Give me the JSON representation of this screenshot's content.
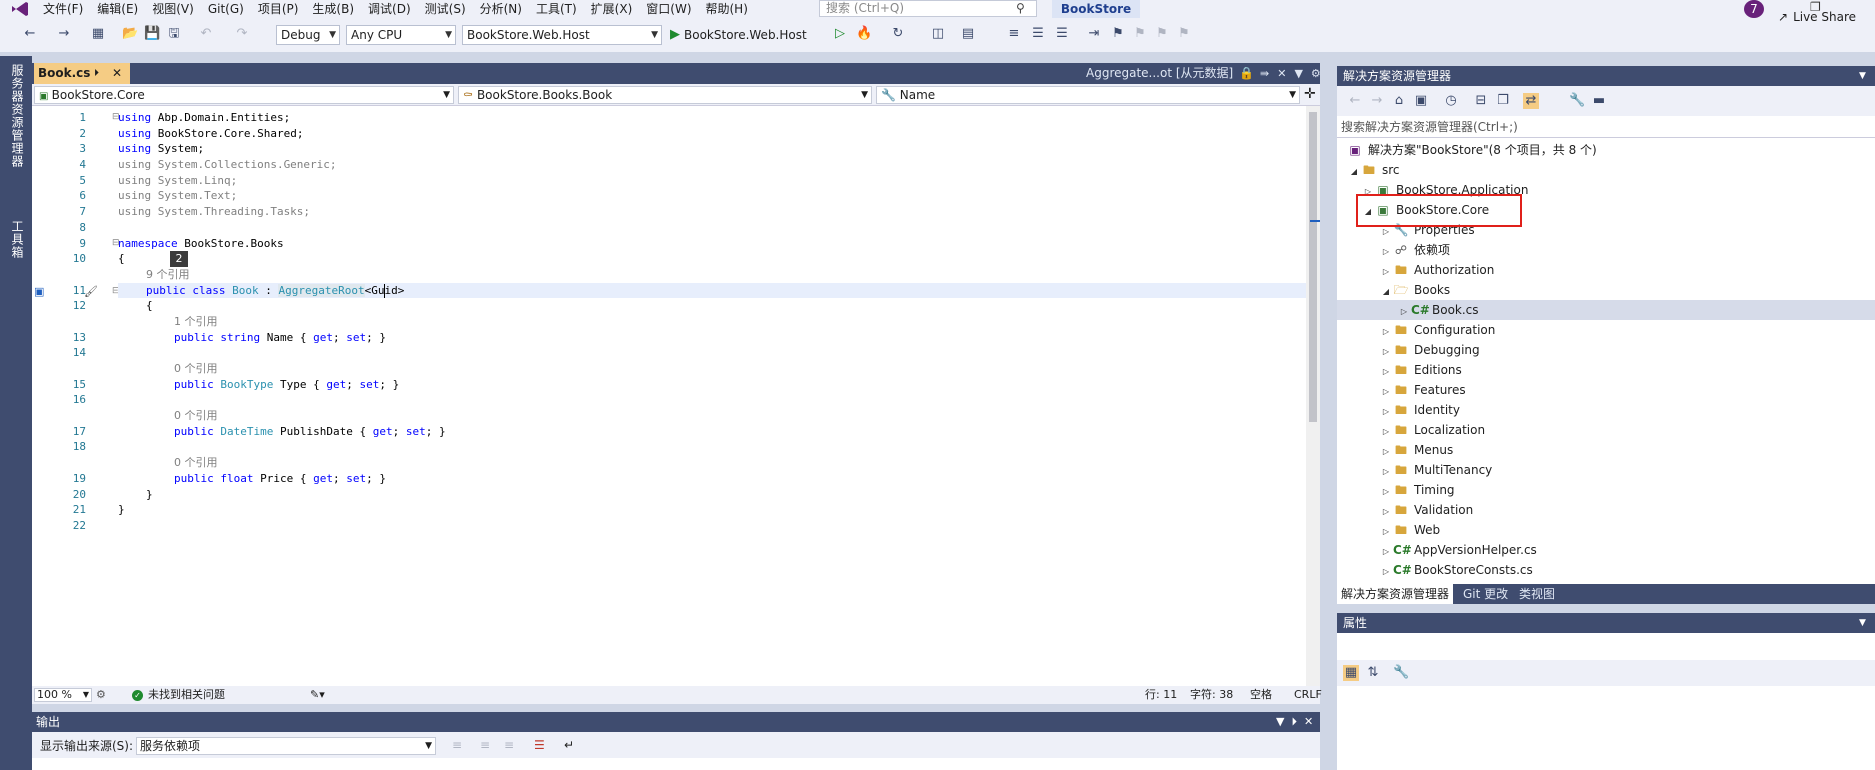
{
  "menubar": {
    "items": [
      "文件(F)",
      "编辑(E)",
      "视图(V)",
      "Git(G)",
      "项目(P)",
      "生成(B)",
      "调试(D)",
      "测试(S)",
      "分析(N)",
      "工具(T)",
      "扩展(X)",
      "窗口(W)",
      "帮助(H)"
    ],
    "search_placeholder": "搜索 (Ctrl+Q)",
    "solution_name": "BookStore",
    "notification_count": "7"
  },
  "toolbar": {
    "config": "Debug",
    "platform": "Any CPU",
    "startup_project": "BookStore.Web.Host",
    "run_target": "BookStore.Web.Host",
    "live_share": "Live Share"
  },
  "side_tabs": [
    "服务器资源管理器",
    "工具箱"
  ],
  "editor": {
    "active_tab": "Book.cs",
    "preview_tab": "Aggregate...ot [从元数据]",
    "nav_project": "BookStore.Core",
    "nav_class": "BookStore.Books.Book",
    "nav_member": "Name",
    "tooltip_number": "2",
    "line_numbers": [
      "1",
      "2",
      "3",
      "4",
      "5",
      "6",
      "7",
      "8",
      "9",
      "10",
      "11",
      "12",
      "13",
      "14",
      "15",
      "16",
      "17",
      "18",
      "19",
      "20",
      "21",
      "22"
    ],
    "lens": {
      "nine_refs": "9 个引用",
      "one_ref": "1 个引用",
      "zero_refs": "0 个引用"
    },
    "code": {
      "l1_kw": "using",
      "l1_rest": " Abp.Domain.Entities;",
      "l2_kw": "using",
      "l2_rest": " BookStore.Core.Shared;",
      "l3_kw": "using",
      "l3_rest": " System;",
      "l4": "using System.Collections.Generic;",
      "l5": "using System.Linq;",
      "l6": "using System.Text;",
      "l7": "using System.Threading.Tasks;",
      "l9_kw": "namespace",
      "l9_rest": " BookStore.Books",
      "l10": "{",
      "l11_kw": "public class",
      "l11_name": " Book",
      "l11_colon": " : ",
      "l11_base": "AggregateRoot",
      "l11_generic": "<Guid>",
      "l12": "{",
      "l13_kw": "public string",
      "l13_rest": " Name { ",
      "l13_get": "get",
      "l13_mid": "; ",
      "l13_set": "set",
      "l13_end": "; }",
      "l15_kw": "public",
      "l15_type": " BookType",
      "l15_rest": " Type { ",
      "l15_get": "get",
      "l15_mid": "; ",
      "l15_set": "set",
      "l15_end": "; }",
      "l17_kw": "public",
      "l17_type": " DateTime",
      "l17_rest": " PublishDate { ",
      "l17_get": "get",
      "l17_mid": "; ",
      "l17_set": "set",
      "l17_end": "; }",
      "l19_kw": "public float",
      "l19_rest": " Price { ",
      "l19_get": "get",
      "l19_mid": "; ",
      "l19_set": "set",
      "l19_end": "; }",
      "l20": "}",
      "l21": "}"
    }
  },
  "editor_status": {
    "zoom": "100 %",
    "issues": "未找到相关问题",
    "line": "行: 11",
    "column": "字符: 38",
    "whitespace": "空格",
    "line_ending": "CRLF"
  },
  "output": {
    "title": "输出",
    "source_label": "显示输出来源(S):",
    "source_value": "服务依赖项"
  },
  "solution_explorer": {
    "title": "解决方案资源管理器",
    "search_placeholder": "搜索解决方案资源管理器(Ctrl+;)",
    "items": [
      {
        "label": "解决方案\"BookStore\"(8 个项目，共 8 个)",
        "icon": "solution-icon"
      },
      {
        "label": "src",
        "icon": "folder-icon"
      },
      {
        "label": "BookStore.Application",
        "icon": "csharp-project-icon"
      },
      {
        "label": "BookStore.Core",
        "icon": "csharp-project-icon"
      },
      {
        "label": "Properties",
        "icon": "properties-icon"
      },
      {
        "label": "依赖项",
        "icon": "dependencies-icon"
      },
      {
        "label": "Authorization",
        "icon": "folder-icon"
      },
      {
        "label": "Books",
        "icon": "folder-open-icon"
      },
      {
        "label": "Book.cs",
        "icon": "csharp-file-icon"
      },
      {
        "label": "Configuration",
        "icon": "folder-icon"
      },
      {
        "label": "Debugging",
        "icon": "folder-icon"
      },
      {
        "label": "Editions",
        "icon": "folder-icon"
      },
      {
        "label": "Features",
        "icon": "folder-icon"
      },
      {
        "label": "Identity",
        "icon": "folder-icon"
      },
      {
        "label": "Localization",
        "icon": "folder-icon"
      },
      {
        "label": "Menus",
        "icon": "folder-icon"
      },
      {
        "label": "MultiTenancy",
        "icon": "folder-icon"
      },
      {
        "label": "Timing",
        "icon": "folder-icon"
      },
      {
        "label": "Validation",
        "icon": "folder-icon"
      },
      {
        "label": "Web",
        "icon": "folder-icon"
      },
      {
        "label": "AppVersionHelper.cs",
        "icon": "csharp-file-icon"
      },
      {
        "label": "BookStoreConsts.cs",
        "icon": "csharp-file-icon"
      }
    ],
    "tabs": [
      "解决方案资源管理器",
      "Git 更改",
      "类视图"
    ]
  },
  "properties": {
    "title": "属性"
  },
  "colors": {
    "accent_panel": "#3f4c6f",
    "active_tab": "#f5cc84",
    "highlight_box": "#e0201a",
    "keyword": "#0000ff",
    "type": "#2b91af"
  }
}
